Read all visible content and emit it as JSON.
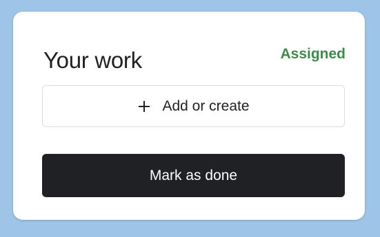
{
  "card": {
    "title": "Your work",
    "status": "Assigned",
    "add_label": "Add or create",
    "add_icon": "plus-icon",
    "done_label": "Mark as done"
  },
  "colors": {
    "status": "#3c8b4b",
    "primary_button": "#202124",
    "background": "#9ec4e8"
  }
}
